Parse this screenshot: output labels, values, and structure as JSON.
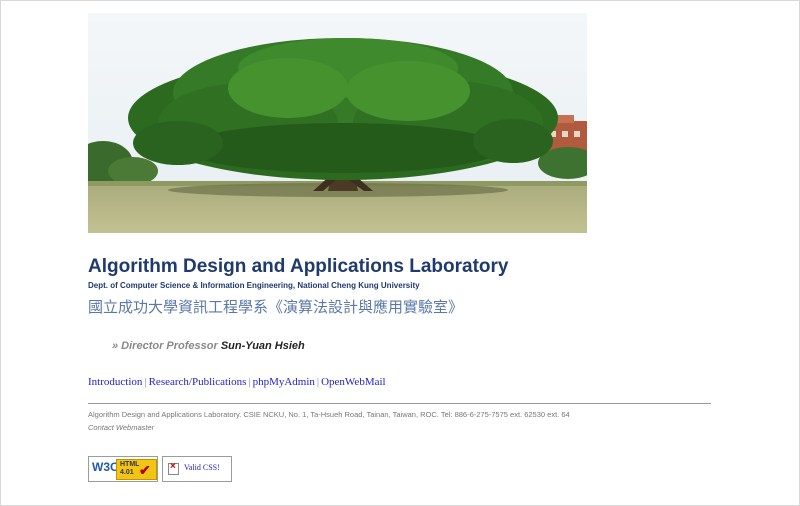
{
  "header": {
    "title": "Algorithm Design and Applications Laboratory",
    "dept": "Dept. of Computer Science & Information Engineering, National Cheng Kung University",
    "chinese": "國立成功大學資訊工程學系《演算法設計與應用實驗室》"
  },
  "director": {
    "label": "» Director Professor",
    "name": "Sun-Yuan Hsieh"
  },
  "nav": {
    "items": [
      "Introduction",
      "Research/Publications",
      "phpMyAdmin",
      "OpenWebMail"
    ],
    "separator": "|"
  },
  "footer": {
    "address": "Algorithm Design and Applications Laboratory. CSIE NCKU, No. 1, Ta-Hsueh Road, Tainan, Taiwan, ROC. Tel: 886-6-275-7575 ext. 62530 ext. 64",
    "contact": "Contact Webmaster"
  },
  "badges": {
    "w3c_logo": "W3C",
    "w3c_html_line1": "HTML",
    "w3c_html_line2": "4.01",
    "css_label": "Valid CSS!"
  },
  "colors": {
    "title": "#1e3a6e",
    "link": "#2222cc",
    "sky": "#eef4f8",
    "foliage": "#2e7a22",
    "grass": "#b7b888"
  }
}
